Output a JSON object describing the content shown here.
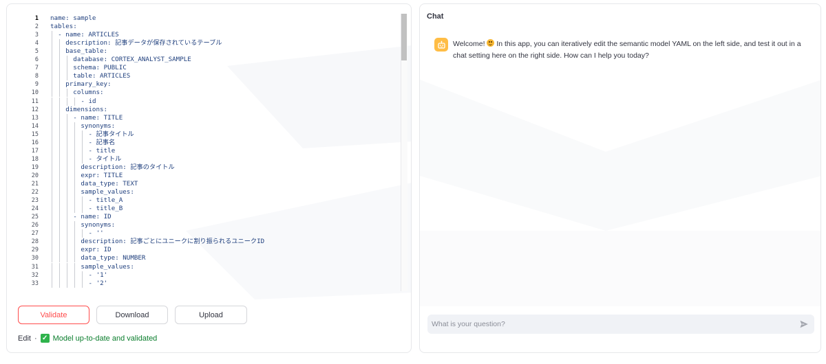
{
  "editor": {
    "active_line": 1,
    "lines": [
      {
        "n": "1",
        "indent": 0,
        "key": "name",
        "sep": ": ",
        "val": "sample"
      },
      {
        "n": "2",
        "indent": 0,
        "key": "tables",
        "sep": ":",
        "val": ""
      },
      {
        "n": "3",
        "indent": 1,
        "key": "- name",
        "sep": ": ",
        "val": "ARTICLES"
      },
      {
        "n": "4",
        "indent": 2,
        "key": "description",
        "sep": ": ",
        "val": "記事データが保存されているテーブル"
      },
      {
        "n": "5",
        "indent": 2,
        "key": "base_table",
        "sep": ":",
        "val": ""
      },
      {
        "n": "6",
        "indent": 3,
        "key": "database",
        "sep": ": ",
        "val": "CORTEX_ANALYST_SAMPLE"
      },
      {
        "n": "7",
        "indent": 3,
        "key": "schema",
        "sep": ": ",
        "val": "PUBLIC"
      },
      {
        "n": "8",
        "indent": 3,
        "key": "table",
        "sep": ": ",
        "val": "ARTICLES"
      },
      {
        "n": "9",
        "indent": 2,
        "key": "primary_key",
        "sep": ":",
        "val": ""
      },
      {
        "n": "10",
        "indent": 3,
        "key": "columns",
        "sep": ":",
        "val": ""
      },
      {
        "n": "11",
        "indent": 4,
        "key": "- id",
        "sep": "",
        "val": ""
      },
      {
        "n": "12",
        "indent": 2,
        "key": "dimensions",
        "sep": ":",
        "val": ""
      },
      {
        "n": "13",
        "indent": 3,
        "key": "- name",
        "sep": ": ",
        "val": "TITLE"
      },
      {
        "n": "14",
        "indent": 4,
        "key": "synonyms",
        "sep": ":",
        "val": ""
      },
      {
        "n": "15",
        "indent": 5,
        "key": "- 記事タイトル",
        "sep": "",
        "val": ""
      },
      {
        "n": "16",
        "indent": 5,
        "key": "- 記事名",
        "sep": "",
        "val": ""
      },
      {
        "n": "17",
        "indent": 5,
        "key": "- title",
        "sep": "",
        "val": ""
      },
      {
        "n": "18",
        "indent": 5,
        "key": "- タイトル",
        "sep": "",
        "val": ""
      },
      {
        "n": "19",
        "indent": 4,
        "key": "description",
        "sep": ": ",
        "val": "記事のタイトル"
      },
      {
        "n": "20",
        "indent": 4,
        "key": "expr",
        "sep": ": ",
        "val": "TITLE"
      },
      {
        "n": "21",
        "indent": 4,
        "key": "data_type",
        "sep": ": ",
        "val": "TEXT"
      },
      {
        "n": "22",
        "indent": 4,
        "key": "sample_values",
        "sep": ":",
        "val": ""
      },
      {
        "n": "23",
        "indent": 5,
        "key": "- title_A",
        "sep": "",
        "val": ""
      },
      {
        "n": "24",
        "indent": 5,
        "key": "- title_B",
        "sep": "",
        "val": ""
      },
      {
        "n": "25",
        "indent": 3,
        "key": "- name",
        "sep": ": ",
        "val": "ID"
      },
      {
        "n": "26",
        "indent": 4,
        "key": "synonyms",
        "sep": ":",
        "val": ""
      },
      {
        "n": "27",
        "indent": 5,
        "key": "- ''",
        "sep": "",
        "val": ""
      },
      {
        "n": "28",
        "indent": 4,
        "key": "description",
        "sep": ": ",
        "val": "記事ごとにユニークに割り振られるユニークID"
      },
      {
        "n": "29",
        "indent": 4,
        "key": "expr",
        "sep": ": ",
        "val": "ID"
      },
      {
        "n": "30",
        "indent": 4,
        "key": "data_type",
        "sep": ": ",
        "val": "NUMBER"
      },
      {
        "n": "31",
        "indent": 4,
        "key": "sample_values",
        "sep": ":",
        "val": ""
      },
      {
        "n": "32",
        "indent": 5,
        "key": "- '1'",
        "sep": "",
        "val": ""
      },
      {
        "n": "33",
        "indent": 5,
        "key": "- '2'",
        "sep": "",
        "val": ""
      }
    ]
  },
  "buttons": {
    "validate": "Validate",
    "download": "Download",
    "upload": "Upload"
  },
  "status": {
    "mode": "Edit",
    "separator": "·",
    "check_icon": "check-mark-icon",
    "message": "Model up-to-date and validated"
  },
  "chat": {
    "title": "Chat",
    "avatar_icon": "robot-icon",
    "emoji_icon": "smiley-emoji-icon",
    "message_before_emoji": "Welcome!",
    "message_after_emoji": "In this app, you can iteratively edit the semantic model YAML on the left side, and test it out in a chat setting here on the right side. How can I help you today?",
    "input_placeholder": "What is your question?",
    "send_icon": "send-icon"
  },
  "colors": {
    "accent": "#ff4b4b",
    "avatar_bg": "#ffbd45",
    "success": "#2fb34c",
    "code_text": "#1f3f7d"
  }
}
